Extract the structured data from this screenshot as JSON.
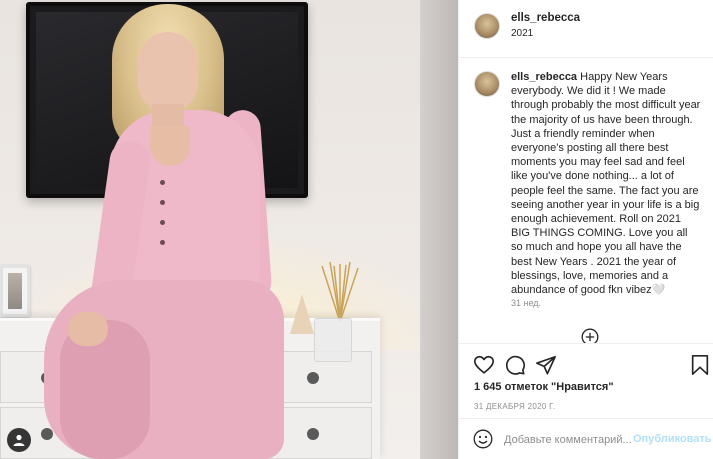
{
  "post": {
    "username": "ells_rebecca",
    "header_subtitle": "2021",
    "caption_username": "ells_rebecca",
    "caption_text": "Happy New Years everybody. We did it ! We made through probably the most difficult year the majority of us have been through. Just a friendly reminder when everyone's posting all there best moments you may feel sad and feel like you've done nothing... a lot of people feel the same. The fact you are seeing another year in your life is a big enough achievement. Roll on 2021 BIG THINGS COMING. Love you all so much and hope you all have the best New Years . 2021 the year of blessings, love, memories and a abundance of good fkn vibez🤍",
    "caption_time": "31 нед.",
    "likes": "1 645 отметок \"Нравится\"",
    "date": "31 ДЕКАБРЯ 2020 Г."
  },
  "comment": {
    "placeholder": "Добавьте комментарий...",
    "publish_label": "Опубликовать"
  },
  "icons": {
    "like": "heart-icon",
    "comment": "comment-icon",
    "share": "share-icon",
    "save": "bookmark-icon",
    "emoji": "emoji-icon",
    "load_more": "plus-circle-icon",
    "account": "user-icon"
  },
  "colors": {
    "publish_disabled": "#b2dffc",
    "secondary_text": "#8e8e8e",
    "primary_text": "#262626",
    "outfit_pink": "#efb9c9"
  }
}
